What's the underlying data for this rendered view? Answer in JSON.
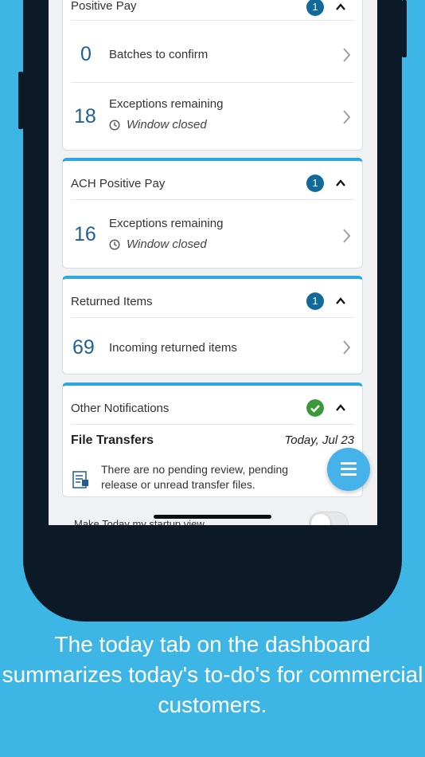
{
  "positive_pay": {
    "title": "Positive Pay",
    "badge": "1",
    "batches_count": "0",
    "batches_label": "Batches to confirm",
    "exceptions_count": "18",
    "exceptions_label": "Exceptions remaining",
    "window_status": "Window closed"
  },
  "ach_positive_pay": {
    "title": "ACH Positive Pay",
    "badge": "1",
    "exceptions_count": "16",
    "exceptions_label": "Exceptions remaining",
    "window_status": "Window closed"
  },
  "returned_items": {
    "title": "Returned Items",
    "badge": "1",
    "count": "69",
    "label": "Incoming returned items"
  },
  "other_notifications": {
    "title": "Other Notifications",
    "file_transfers_title": "File Transfers",
    "file_transfers_date": "Today, Jul 23",
    "file_transfers_message": "There are no pending review, pending release or unread transfer files."
  },
  "startup_label": "Make Today my startup view",
  "caption": "The today tab on the dashboard summarizes today's to-do's for commercial customers.",
  "colors": {
    "background": "#3db6e6",
    "accent": "#2aa8df",
    "badge": "#116a9c",
    "number": "#1f5f93",
    "success": "#3a9a3a"
  }
}
